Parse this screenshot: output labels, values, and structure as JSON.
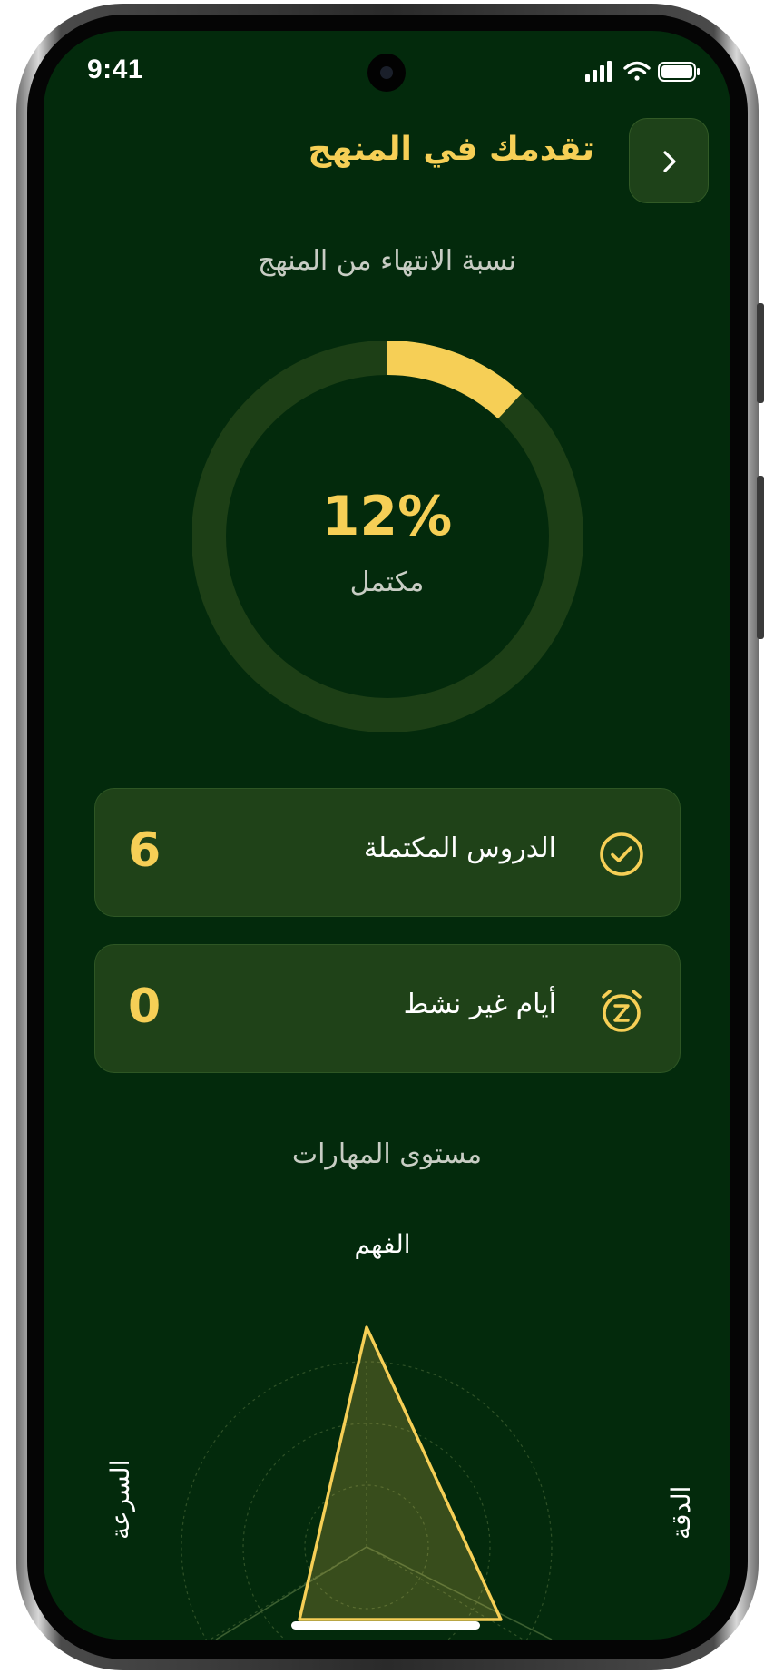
{
  "status_bar": {
    "time": "9:41",
    "icons": [
      "cellular-signal-icon",
      "wifi-icon",
      "battery-icon"
    ]
  },
  "header": {
    "title": "تقدمك في المنهج",
    "back_icon": "chevron-right-icon"
  },
  "progress": {
    "section_label": "نسبة الانتهاء من المنهج",
    "percent_text": "12%",
    "percent_value": 0.12,
    "caption": "مكتمل"
  },
  "stats": [
    {
      "label": "الدروس المكتملة",
      "value": "6",
      "icon": "check-circle-icon"
    },
    {
      "label": "أيام غير نشط",
      "value": "0",
      "icon": "snooze-alarm-icon"
    }
  ],
  "skills": {
    "section_label": "مستوى المهارات",
    "axes": [
      "الفهم",
      "الدقة",
      "السرعة"
    ]
  },
  "colors": {
    "background": "#032a0c",
    "accent": "#f6cf56",
    "card": "#1f4218",
    "ring_track": "#1d3f16",
    "muted_text": "#c8cdc4"
  }
}
